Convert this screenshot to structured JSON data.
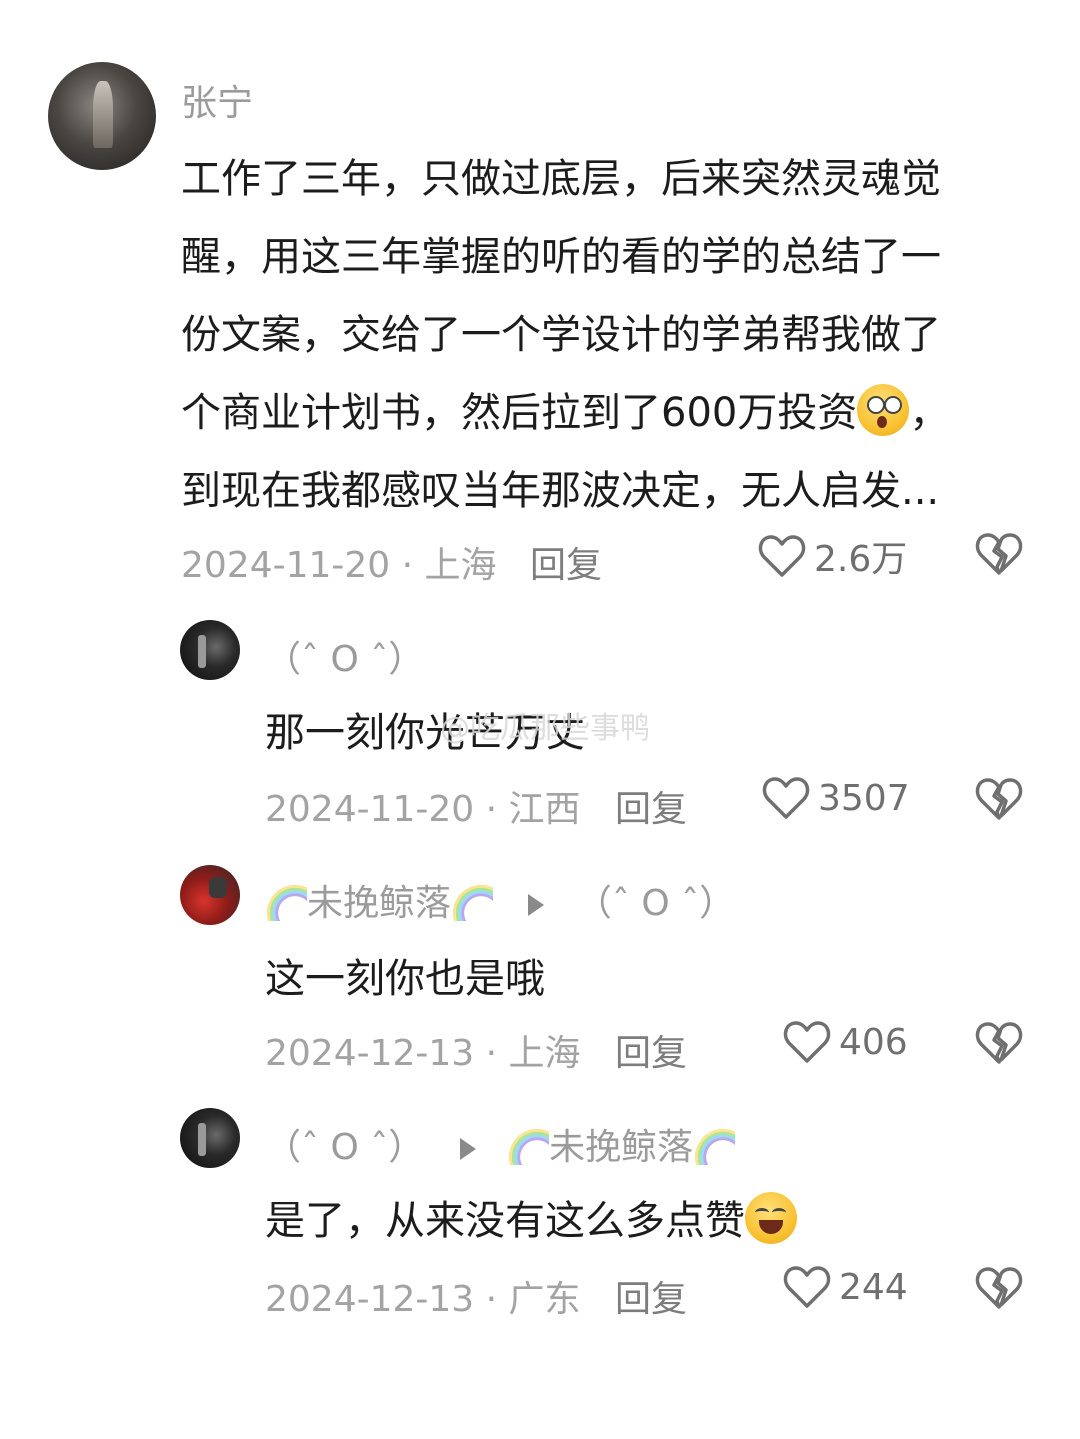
{
  "comments": [
    {
      "author": "张宁",
      "text_lines": [
        "工作了三年，只做过底层，后来突然灵魂觉",
        "醒，用这三年掌握的听的看的学的总结了一",
        "份文案，交给了一个学设计的学弟帮我做了",
        "个商业计划书，然后拉到了600万投资",
        "到现在我都感叹当年那波决定，无人启发..."
      ],
      "line4_suffix": "，",
      "meta": "2024-11-20 · 上海",
      "reply_label": "回复",
      "likes": "2.6万"
    }
  ],
  "replies": [
    {
      "author": "（ˆ O ˆ）",
      "text": "那一刻你光芒万丈",
      "meta": "2024-11-20 · 江西",
      "reply_label": "回复",
      "likes": "3507"
    },
    {
      "author": "未挽鲸落",
      "reply_to": "（ˆ O ˆ）",
      "text": "这一刻你也是哦",
      "meta": "2024-12-13 · 上海",
      "reply_label": "回复",
      "likes": "406"
    },
    {
      "author": "（ˆ O ˆ）",
      "reply_to": "未挽鲸落",
      "text": "是了，从来没有这么多点赞",
      "meta": "2024-12-13 · 广东",
      "reply_label": "回复",
      "likes": "244"
    }
  ],
  "watermark": "@吃瓜那些事鸭",
  "icons": {
    "like": "heart-outline-icon",
    "dislike": "broken-heart-icon",
    "reply_arrow": "play-arrow-icon",
    "emoji_1": "astonished-emoji-icon",
    "emoji_2": "rolling-laughing-emoji-icon",
    "name_decoration": "rainbow-icon"
  },
  "colors": {
    "text": "#1c1c1c",
    "meta": "#a3a3a3",
    "name": "#9b9b9b"
  }
}
